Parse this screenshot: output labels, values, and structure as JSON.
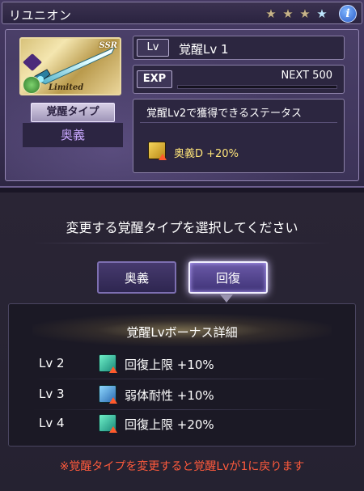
{
  "header": {
    "title": "リユニオン",
    "stars": [
      "star",
      "star",
      "star",
      "star-blue"
    ],
    "info_icon": "info-icon",
    "info_label": "i"
  },
  "weapon": {
    "rarity": "SSR",
    "tag": "Limited",
    "element_icon": "dark-element-icon",
    "type_icon": "staff-type-icon"
  },
  "awaken": {
    "type_label": "覚醒タイプ",
    "type_value": "奥義"
  },
  "level": {
    "tag": "Lv",
    "value": "覚醒Lv 1"
  },
  "exp": {
    "tag": "EXP",
    "next": "NEXT 500",
    "progress": 0
  },
  "status": {
    "title": "覚醒Lv2で獲得できるステータス",
    "icon": "ougi-damage-icon",
    "text": "奥義D +20%"
  },
  "selector": {
    "prompt": "変更する覚醒タイプを選択してください",
    "options": [
      "奥義",
      "回復"
    ],
    "selected": "回復"
  },
  "bonus": {
    "title": "覚醒Lvボーナス詳細",
    "rows": [
      {
        "lv": "Lv 2",
        "icon": "heal-cap-icon",
        "text": "回復上限 +10%"
      },
      {
        "lv": "Lv 3",
        "icon": "debuff-resist-icon",
        "text": "弱体耐性 +10%"
      },
      {
        "lv": "Lv 4",
        "icon": "heal-cap-icon",
        "text": "回復上限 +20%"
      }
    ]
  },
  "warning": "※覚醒タイプを変更すると覚醒Lvが1に戻ります",
  "colors": {
    "accent": "#c9a8ff",
    "gold": "#ffe57a",
    "warning": "#ff5a3c",
    "exp_bar": "#6ad2ff"
  }
}
